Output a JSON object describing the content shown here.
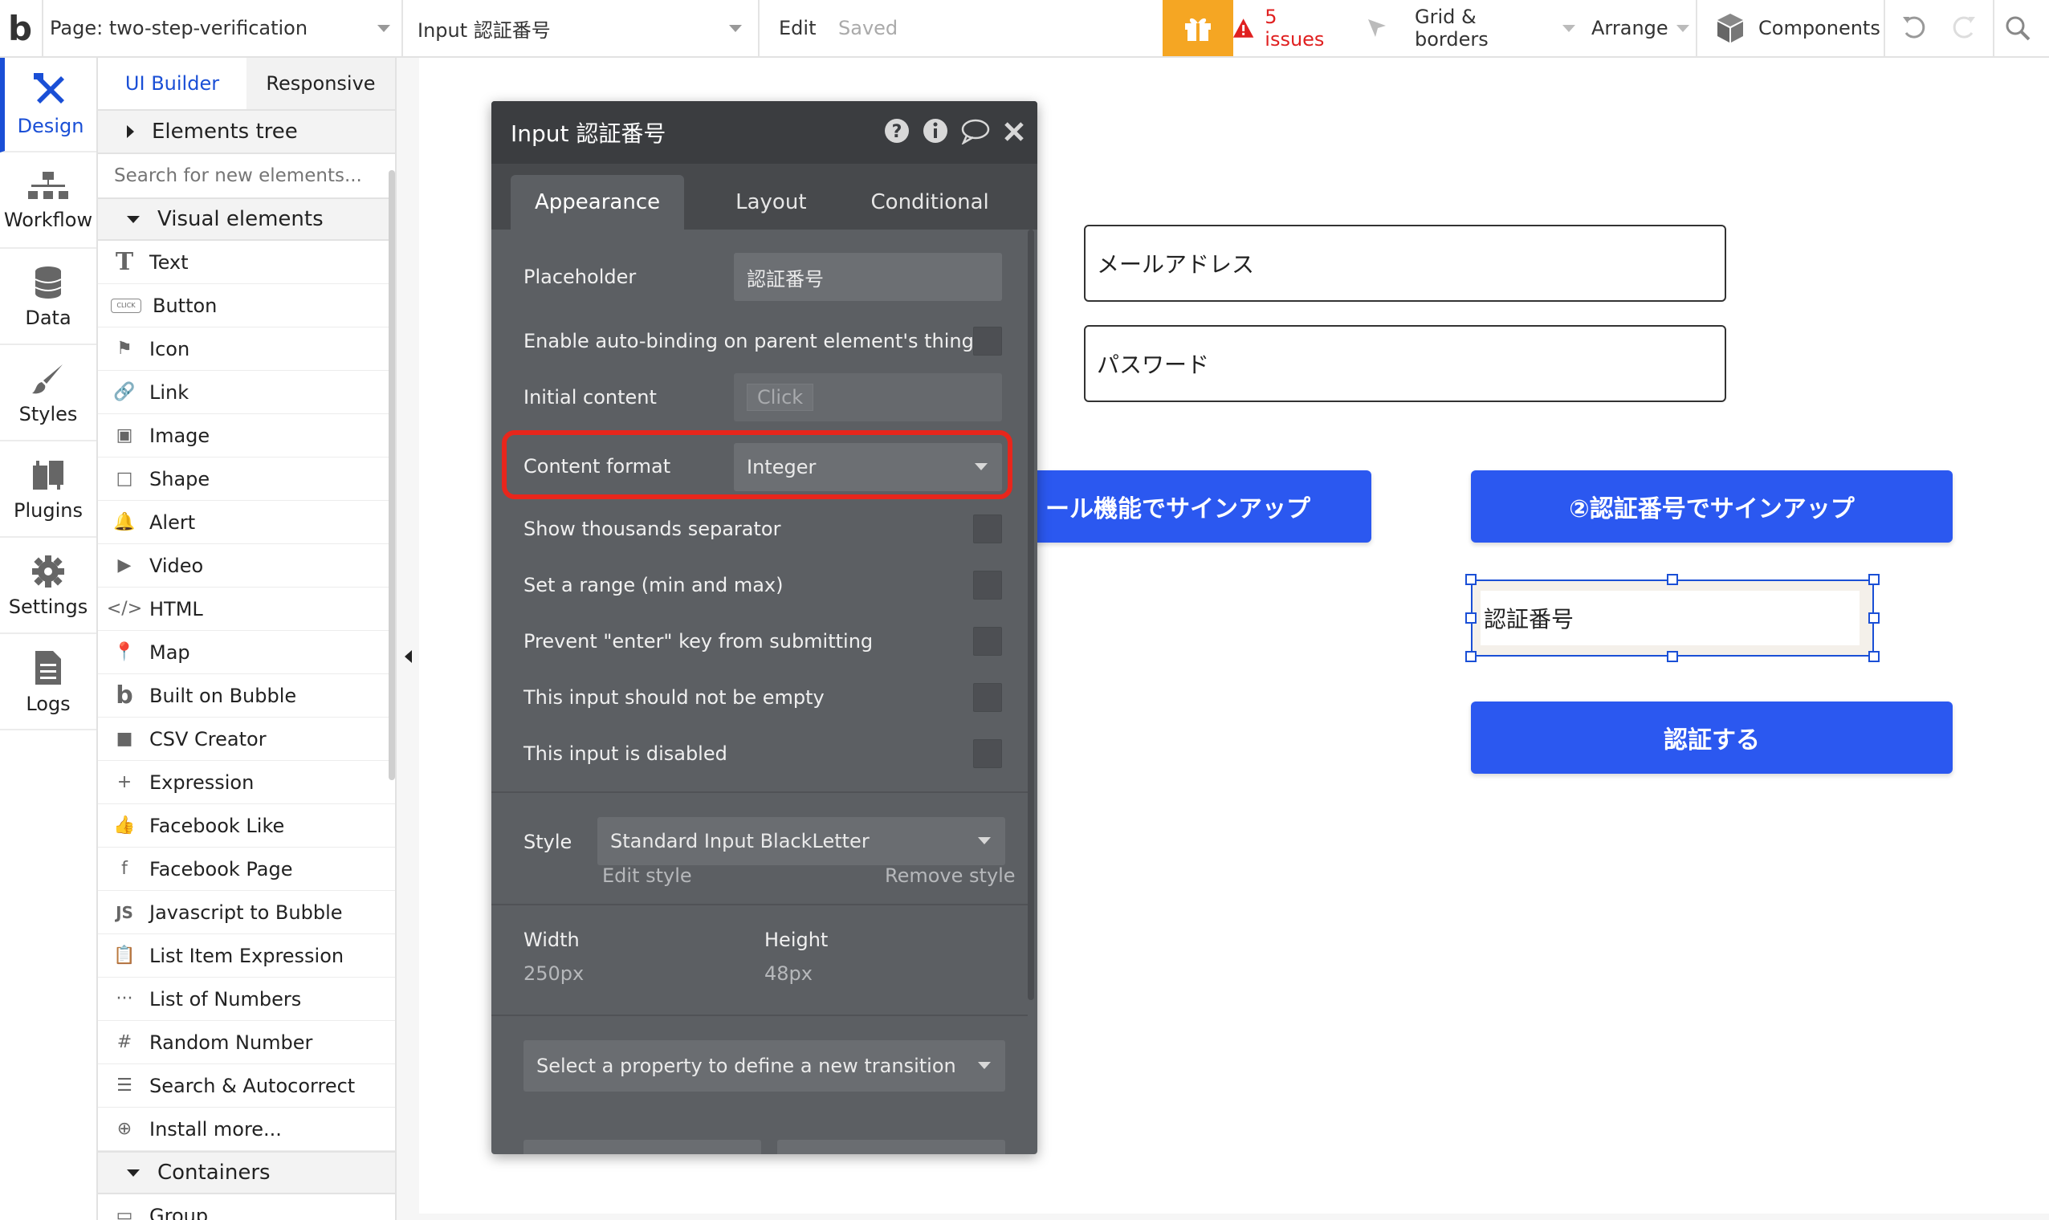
{
  "topbar": {
    "logo": "b",
    "page_selector": "Page: two-step-verification",
    "element_selector": "Input 認証番号",
    "edit_label": "Edit",
    "saved_label": "Saved",
    "issues_label": "5 issues",
    "grid_label": "Grid & borders",
    "arrange_label": "Arrange",
    "components_label": "Components",
    "accent_color": "#f5a623",
    "issues_color": "#e02020"
  },
  "rail": {
    "items": [
      {
        "label": "Design",
        "icon": "design-icon"
      },
      {
        "label": "Workflow",
        "icon": "workflow-icon"
      },
      {
        "label": "Data",
        "icon": "database-icon"
      },
      {
        "label": "Styles",
        "icon": "brush-icon"
      },
      {
        "label": "Plugins",
        "icon": "plug-icon"
      },
      {
        "label": "Settings",
        "icon": "gear-icon"
      },
      {
        "label": "Logs",
        "icon": "document-icon"
      }
    ]
  },
  "palette": {
    "tabs": [
      "UI Builder",
      "Responsive"
    ],
    "elements_tree": "Elements tree",
    "search_placeholder": "Search for new elements...",
    "visual_elements": "Visual elements",
    "items": [
      {
        "label": "Text",
        "icon": "text-icon",
        "glyph": "T"
      },
      {
        "label": "Button",
        "icon": "button-icon",
        "glyph": "CLICK"
      },
      {
        "label": "Icon",
        "icon": "flag-icon",
        "glyph": "⚑"
      },
      {
        "label": "Link",
        "icon": "link-icon",
        "glyph": "🔗"
      },
      {
        "label": "Image",
        "icon": "image-icon",
        "glyph": "▣"
      },
      {
        "label": "Shape",
        "icon": "shape-icon",
        "glyph": "□"
      },
      {
        "label": "Alert",
        "icon": "bell-icon",
        "glyph": "🔔"
      },
      {
        "label": "Video",
        "icon": "video-icon",
        "glyph": "▶"
      },
      {
        "label": "HTML",
        "icon": "code-icon",
        "glyph": "</>"
      },
      {
        "label": "Map",
        "icon": "pin-icon",
        "glyph": "📍"
      },
      {
        "label": "Built on Bubble",
        "icon": "bubble-icon",
        "glyph": "b"
      },
      {
        "label": "CSV Creator",
        "icon": "square-icon",
        "glyph": "■"
      },
      {
        "label": "Expression",
        "icon": "plus-icon",
        "glyph": "+"
      },
      {
        "label": "Facebook Like",
        "icon": "thumb-icon",
        "glyph": "👍"
      },
      {
        "label": "Facebook Page",
        "icon": "facebook-icon",
        "glyph": "f"
      },
      {
        "label": "Javascript to Bubble",
        "icon": "js-icon",
        "glyph": "JS"
      },
      {
        "label": "List Item Expression",
        "icon": "clipboard-icon",
        "glyph": "📋"
      },
      {
        "label": "List of Numbers",
        "icon": "ellipsis-icon",
        "glyph": "···"
      },
      {
        "label": "Random Number",
        "icon": "hash-icon",
        "glyph": "#"
      },
      {
        "label": "Search & Autocorrect",
        "icon": "list-icon",
        "glyph": "☰"
      },
      {
        "label": "Install more...",
        "icon": "plus-circle-icon",
        "glyph": "⊕"
      }
    ],
    "containers": "Containers",
    "next_item": "Group"
  },
  "canvas": {
    "email_placeholder": "メールアドレス",
    "password_placeholder": "パスワード",
    "btn_email_signup": "ール機能でサインアップ",
    "btn_code_signup": "②認証番号でサインアップ",
    "code_input_placeholder": "認証番号",
    "btn_verify": "認証する",
    "button_color": "#2b58f0"
  },
  "editor": {
    "title": "Input 認証番号",
    "tabs": [
      "Appearance",
      "Layout",
      "Conditional"
    ],
    "placeholder_label": "Placeholder",
    "placeholder_value": "認証番号",
    "autobinding_label": "Enable auto-binding on parent element's thing",
    "initial_content_label": "Initial content",
    "initial_content_value": "Click",
    "content_format_label": "Content format",
    "content_format_value": "Integer",
    "thousands_label": "Show thousands separator",
    "range_label": "Set a range (min and max)",
    "prevent_enter_label": "Prevent \"enter\" key from submitting",
    "not_empty_label": "This input should not be empty",
    "disabled_label": "This input is disabled",
    "style_label": "Style",
    "style_value": "Standard Input BlackLetter",
    "edit_style": "Edit style",
    "remove_style": "Remove style",
    "width_label": "Width",
    "width_value": "250px",
    "height_label": "Height",
    "height_value": "48px",
    "transition_placeholder": "Select a property to define a new transition",
    "highlight_color": "#e8261c"
  }
}
